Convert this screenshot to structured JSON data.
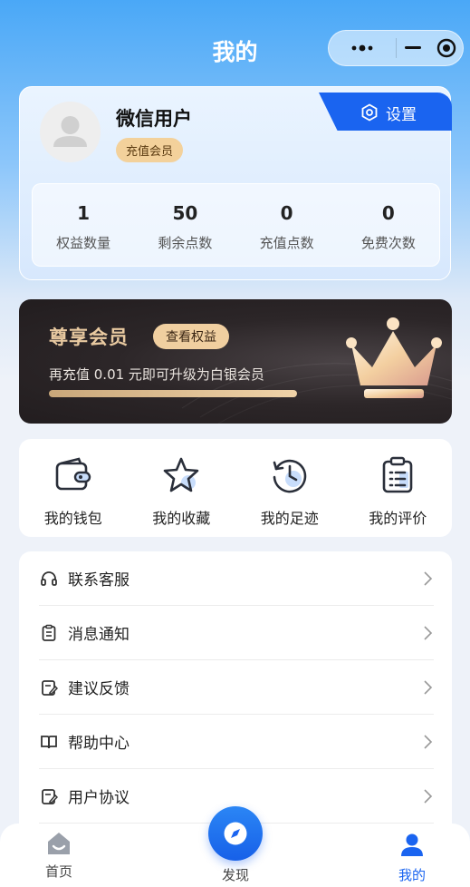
{
  "header": {
    "title": "我的"
  },
  "profile": {
    "username": "微信用户",
    "badge": "充值会员",
    "settings_label": "设置",
    "stats": [
      {
        "value": "1",
        "label": "权益数量"
      },
      {
        "value": "50",
        "label": "剩余点数"
      },
      {
        "value": "0",
        "label": "充值点数"
      },
      {
        "value": "0",
        "label": "免费次数"
      }
    ]
  },
  "vip": {
    "title": "尊享会员",
    "button": "查看权益",
    "description": "再充值 0.01 元即可升级为白银会员",
    "progress": 1.0
  },
  "quick_actions": [
    {
      "label": "我的钱包",
      "icon": "wallet-icon"
    },
    {
      "label": "我的收藏",
      "icon": "star-icon"
    },
    {
      "label": "我的足迹",
      "icon": "history-icon"
    },
    {
      "label": "我的评价",
      "icon": "clipboard-icon"
    }
  ],
  "menu": [
    {
      "label": "联系客服",
      "icon": "headset-icon"
    },
    {
      "label": "消息通知",
      "icon": "notice-icon"
    },
    {
      "label": "建议反馈",
      "icon": "edit-icon"
    },
    {
      "label": "帮助中心",
      "icon": "help-book-icon"
    },
    {
      "label": "用户协议",
      "icon": "agreement-icon"
    }
  ],
  "tabbar": {
    "home": "首页",
    "discover": "发现",
    "mine": "我的",
    "active": "mine",
    "active_color": "#1a64f0",
    "inactive_color": "#444444"
  },
  "colors": {
    "primary": "#1a64f0",
    "gold": "#f0cfa0",
    "badge_bg": "#f3d19b"
  }
}
